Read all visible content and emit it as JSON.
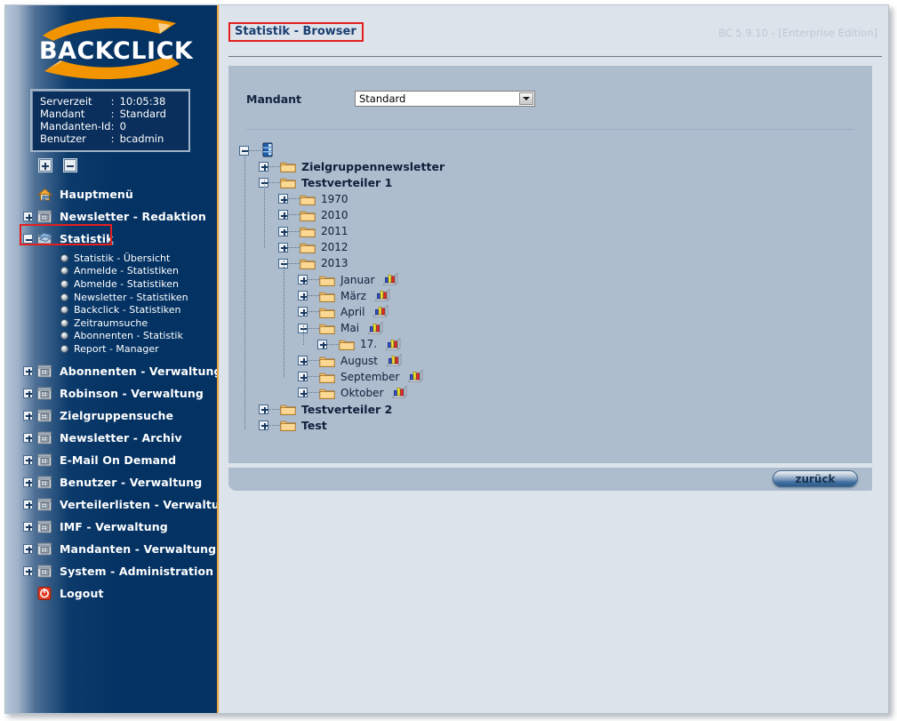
{
  "brand": {
    "logo_text": "BACKCLICK"
  },
  "server_info": {
    "rows": [
      {
        "key": "Serverzeit",
        "value": "10:05:38"
      },
      {
        "key": "Mandant",
        "value": "Standard"
      },
      {
        "key": "Mandanten-Id",
        "value": "0"
      },
      {
        "key": "Benutzer",
        "value": "bcadmin"
      }
    ],
    "separator": ":"
  },
  "tree_toolbar": {
    "expand_all_icon": "plus-square-icon",
    "collapse_all_icon": "minus-square-icon"
  },
  "sidebar": {
    "items": [
      {
        "label": "Hauptmenü",
        "icon": "home-icon",
        "expander": "none",
        "selected": false
      },
      {
        "label": "Newsletter - Redaktion",
        "icon": "folder-window-icon",
        "expander": "plus",
        "selected": false
      },
      {
        "label": "Statistik",
        "icon": "statistik-icon",
        "expander": "minus",
        "selected": true
      },
      {
        "label": "Abonnenten - Verwaltung",
        "icon": "folder-window-icon",
        "expander": "plus",
        "selected": false
      },
      {
        "label": "Robinson - Verwaltung",
        "icon": "folder-window-icon",
        "expander": "plus",
        "selected": false
      },
      {
        "label": "Zielgruppensuche",
        "icon": "folder-window-icon",
        "expander": "plus",
        "selected": false
      },
      {
        "label": "Newsletter - Archiv",
        "icon": "folder-window-icon",
        "expander": "plus",
        "selected": false
      },
      {
        "label": "E-Mail On Demand",
        "icon": "folder-window-icon",
        "expander": "plus",
        "selected": false
      },
      {
        "label": "Benutzer - Verwaltung",
        "icon": "folder-window-icon",
        "expander": "plus",
        "selected": false
      },
      {
        "label": "Verteilerlisten - Verwaltung",
        "icon": "folder-window-icon",
        "expander": "plus",
        "selected": false
      },
      {
        "label": "IMF - Verwaltung",
        "icon": "folder-window-icon",
        "expander": "plus",
        "selected": false
      },
      {
        "label": "Mandanten - Verwaltung",
        "icon": "folder-window-icon",
        "expander": "plus",
        "selected": false
      },
      {
        "label": "System - Administration",
        "icon": "folder-window-icon",
        "expander": "plus",
        "selected": false
      },
      {
        "label": "Logout",
        "icon": "power-off-icon",
        "expander": "none",
        "selected": false
      }
    ],
    "statistik_subitems": [
      {
        "label": "Statistik - Übersicht"
      },
      {
        "label": "Anmelde - Statistiken"
      },
      {
        "label": "Abmelde - Statistiken"
      },
      {
        "label": "Newsletter - Statistiken"
      },
      {
        "label": "Backclick - Statistiken"
      },
      {
        "label": "Zeitraumsuche"
      },
      {
        "label": "Abonnenten - Statistik"
      },
      {
        "label": "Report - Manager"
      }
    ]
  },
  "header": {
    "page_title": "Statistik - Browser",
    "version": "BC 5.9.10 - [Enterprise Edition]"
  },
  "form": {
    "mandant_label": "Mandant",
    "mandant_value": "Standard",
    "mandant_options": [
      "Standard"
    ],
    "dropdown_icon": "chevron-down-icon"
  },
  "tree": {
    "root": {
      "label": "",
      "icon": "server-root-icon",
      "expander": "minus"
    },
    "nodes": [
      {
        "label": "Zielgruppennewsletter",
        "depth": 1,
        "expander": "plus",
        "bold": true,
        "chart": false
      },
      {
        "label": "Testverteiler 1",
        "depth": 1,
        "expander": "minus",
        "bold": true,
        "chart": false
      },
      {
        "label": "1970",
        "depth": 2,
        "expander": "plus",
        "bold": false,
        "chart": false
      },
      {
        "label": "2010",
        "depth": 2,
        "expander": "plus",
        "bold": false,
        "chart": false
      },
      {
        "label": "2011",
        "depth": 2,
        "expander": "plus",
        "bold": false,
        "chart": false
      },
      {
        "label": "2012",
        "depth": 2,
        "expander": "plus",
        "bold": false,
        "chart": false
      },
      {
        "label": "2013",
        "depth": 2,
        "expander": "minus",
        "bold": false,
        "chart": false
      },
      {
        "label": "Januar",
        "depth": 3,
        "expander": "plus",
        "bold": false,
        "chart": true
      },
      {
        "label": "März",
        "depth": 3,
        "expander": "plus",
        "bold": false,
        "chart": true
      },
      {
        "label": "April",
        "depth": 3,
        "expander": "plus",
        "bold": false,
        "chart": true
      },
      {
        "label": "Mai",
        "depth": 3,
        "expander": "minus",
        "bold": false,
        "chart": true
      },
      {
        "label": "17.",
        "depth": 4,
        "expander": "plus",
        "bold": false,
        "chart": true
      },
      {
        "label": "August",
        "depth": 3,
        "expander": "plus",
        "bold": false,
        "chart": true
      },
      {
        "label": "September",
        "depth": 3,
        "expander": "plus",
        "bold": false,
        "chart": true
      },
      {
        "label": "Oktober",
        "depth": 3,
        "expander": "plus",
        "bold": false,
        "chart": true
      },
      {
        "label": "Testverteiler 2",
        "depth": 1,
        "expander": "plus",
        "bold": true,
        "chart": false
      },
      {
        "label": "Test",
        "depth": 1,
        "expander": "plus",
        "bold": true,
        "chart": false
      }
    ],
    "chart_icon": "bar-chart-icon",
    "folder_icon": "folder-icon"
  },
  "footer": {
    "back_label": "zurück"
  },
  "colors": {
    "sidebar_dark": "#033263",
    "sidebar_light": "#b7c6d8",
    "sidebar_border": "#e8a33d",
    "content_bg": "#dce3ea",
    "panel_bg": "#adbdce",
    "title_text": "#1b3f72",
    "highlight_red": "#e3201e",
    "version_text": "#bcc8d5",
    "brand_orange": "#f29400"
  }
}
